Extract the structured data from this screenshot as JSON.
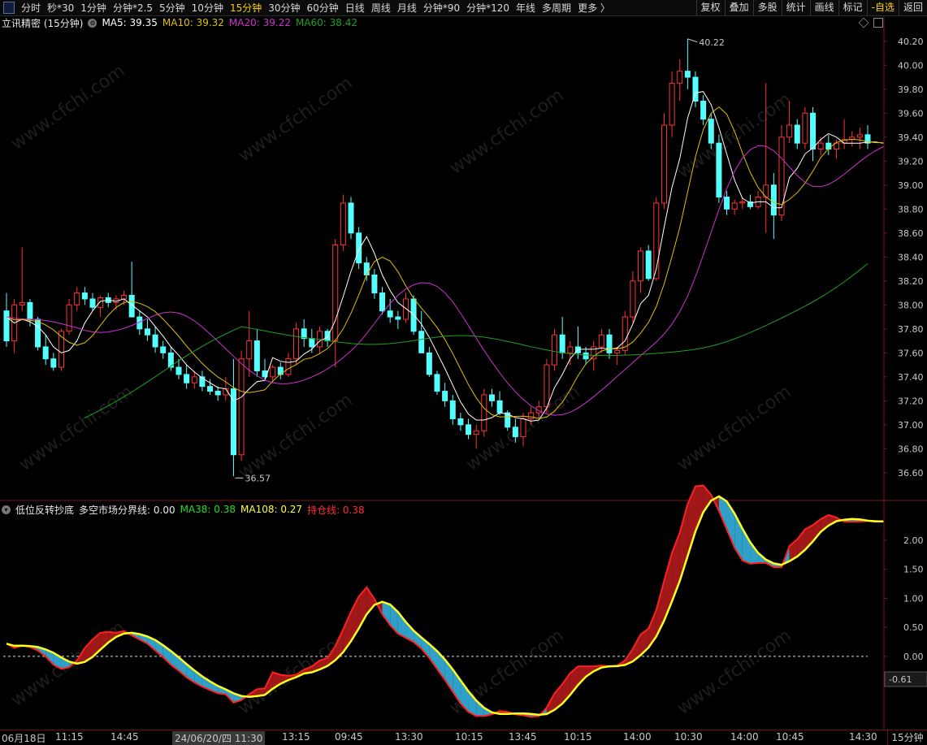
{
  "toolbar": {
    "periods": [
      "分时",
      "秒*30",
      "1分钟",
      "分钟*2.5",
      "5分钟",
      "10分钟",
      "15分钟",
      "30分钟",
      "60分钟",
      "日线",
      "周线",
      "月线",
      "分钟*90",
      "分钟*120",
      "年线",
      "多周期",
      "更多 〉"
    ],
    "active_period": "15分钟",
    "right_tools": [
      "复权",
      "叠加",
      "多股",
      "统计",
      "画线",
      "标记",
      "-自选",
      "返回"
    ]
  },
  "main_legend": {
    "title": "立讯精密 (15分钟)",
    "ma5": "MA5: 39.35",
    "ma10": "MA10: 39.32",
    "ma20": "MA20: 39.22",
    "ma60": "MA60: 38.42"
  },
  "sub_legend": {
    "title": "低位反转抄底",
    "dk": "多空市场分界线: 0.00",
    "ma38": "MA38: 0.38",
    "ma108": "MA108: 0.27",
    "hold": "持仓线: 0.38"
  },
  "annotations": {
    "high": "40.22",
    "low": "36.57"
  },
  "price_axis": [
    "40.20",
    "40.00",
    "39.80",
    "39.60",
    "39.40",
    "39.20",
    "39.00",
    "38.80",
    "38.60",
    "38.40",
    "38.20",
    "38.00",
    "37.80",
    "37.60",
    "37.40",
    "37.20",
    "37.00",
    "36.80",
    "36.60"
  ],
  "indicator_axis": [
    "2.00",
    "1.50",
    "1.00",
    "0.50",
    "0.00"
  ],
  "indicator_current": "-0.61",
  "time_labels": [
    "06月18日",
    "11:15",
    "14:45",
    "24/06/20/四 11:30",
    "13:15",
    "09:45",
    "13:30",
    "10:15",
    "13:45",
    "10:15",
    "14:00",
    "10:30",
    "14:00",
    "10:45",
    "14:30"
  ],
  "period_tag": "15分钟",
  "colors": {
    "up": "#ff3232",
    "down": "#54ffff",
    "ma5": "#ffffff",
    "ma10": "#e0c000",
    "ma20": "#d030d0",
    "ma60": "#20a020",
    "grid": "#3a0a0a"
  },
  "chart_data": {
    "type": "candlestick",
    "ylim": [
      36.45,
      40.3
    ],
    "candles": [
      [
        37.95,
        38.1,
        37.65,
        37.7
      ],
      [
        37.7,
        38.05,
        37.6,
        38.0
      ],
      [
        38.0,
        38.48,
        37.95,
        38.02
      ],
      [
        38.02,
        38.05,
        37.82,
        37.88
      ],
      [
        37.88,
        37.9,
        37.62,
        37.65
      ],
      [
        37.65,
        37.75,
        37.5,
        37.55
      ],
      [
        37.55,
        37.6,
        37.45,
        37.48
      ],
      [
        37.48,
        37.8,
        37.45,
        37.78
      ],
      [
        37.78,
        38.05,
        37.75,
        38.0
      ],
      [
        38.0,
        38.15,
        37.95,
        38.1
      ],
      [
        38.1,
        38.15,
        38.0,
        38.05
      ],
      [
        38.05,
        38.1,
        37.95,
        37.98
      ],
      [
        37.98,
        38.08,
        37.9,
        38.06
      ],
      [
        38.06,
        38.1,
        37.98,
        38.02
      ],
      [
        38.02,
        38.08,
        37.96,
        38.05
      ],
      [
        38.05,
        38.12,
        38.0,
        38.08
      ],
      [
        38.08,
        38.36,
        37.95,
        37.9
      ],
      [
        37.9,
        37.95,
        37.75,
        37.8
      ],
      [
        37.8,
        37.88,
        37.7,
        37.75
      ],
      [
        37.75,
        37.82,
        37.6,
        37.65
      ],
      [
        37.65,
        37.7,
        37.55,
        37.6
      ],
      [
        37.6,
        37.65,
        37.45,
        37.48
      ],
      [
        37.48,
        37.55,
        37.38,
        37.42
      ],
      [
        37.42,
        37.5,
        37.3,
        37.35
      ],
      [
        37.35,
        37.45,
        37.3,
        37.4
      ],
      [
        37.4,
        37.45,
        37.28,
        37.32
      ],
      [
        37.32,
        37.38,
        37.25,
        37.28
      ],
      [
        37.28,
        37.32,
        37.2,
        37.25
      ],
      [
        37.25,
        37.4,
        37.2,
        37.3
      ],
      [
        37.3,
        37.55,
        36.57,
        36.75
      ],
      [
        36.75,
        37.62,
        36.7,
        37.55
      ],
      [
        37.55,
        37.95,
        37.4,
        37.7
      ],
      [
        37.7,
        37.8,
        37.4,
        37.45
      ],
      [
        37.45,
        37.55,
        37.38,
        37.4
      ],
      [
        37.4,
        37.5,
        37.35,
        37.48
      ],
      [
        37.48,
        37.52,
        37.38,
        37.42
      ],
      [
        37.42,
        37.6,
        37.4,
        37.55
      ],
      [
        37.55,
        37.85,
        37.5,
        37.8
      ],
      [
        37.8,
        37.88,
        37.65,
        37.72
      ],
      [
        37.72,
        37.8,
        37.6,
        37.65
      ],
      [
        37.65,
        37.82,
        37.6,
        37.78
      ],
      [
        37.78,
        37.8,
        37.65,
        37.7
      ],
      [
        37.7,
        38.55,
        37.48,
        38.5
      ],
      [
        38.5,
        38.92,
        38.45,
        38.85
      ],
      [
        38.85,
        38.9,
        38.55,
        38.6
      ],
      [
        38.6,
        38.65,
        38.3,
        38.35
      ],
      [
        38.35,
        38.4,
        38.2,
        38.25
      ],
      [
        38.25,
        38.3,
        38.05,
        38.1
      ],
      [
        38.1,
        38.15,
        37.92,
        37.95
      ],
      [
        37.95,
        38.05,
        37.85,
        37.9
      ],
      [
        37.9,
        37.95,
        37.8,
        37.88
      ],
      [
        37.88,
        38.1,
        37.85,
        38.05
      ],
      [
        38.05,
        38.08,
        37.75,
        37.78
      ],
      [
        37.78,
        37.95,
        37.6,
        37.6
      ],
      [
        37.6,
        37.65,
        37.4,
        37.42
      ],
      [
        37.42,
        37.45,
        37.25,
        37.28
      ],
      [
        37.28,
        37.35,
        37.15,
        37.2
      ],
      [
        37.2,
        37.25,
        37.0,
        37.05
      ],
      [
        37.05,
        37.1,
        36.95,
        37.0
      ],
      [
        37.0,
        37.05,
        36.88,
        36.92
      ],
      [
        36.92,
        37.0,
        36.8,
        36.95
      ],
      [
        36.95,
        37.3,
        36.9,
        37.25
      ],
      [
        37.25,
        37.3,
        37.15,
        37.2
      ],
      [
        37.2,
        37.28,
        37.08,
        37.1
      ],
      [
        37.1,
        37.12,
        36.95,
        36.98
      ],
      [
        36.98,
        37.05,
        36.85,
        36.9
      ],
      [
        36.9,
        37.1,
        36.82,
        37.05
      ],
      [
        37.05,
        37.15,
        37.0,
        37.1
      ],
      [
        37.1,
        37.2,
        37.05,
        37.15
      ],
      [
        37.15,
        37.55,
        37.1,
        37.5
      ],
      [
        37.5,
        37.8,
        37.45,
        37.75
      ],
      [
        37.75,
        37.9,
        37.55,
        37.6
      ],
      [
        37.6,
        37.7,
        37.5,
        37.65
      ],
      [
        37.65,
        37.82,
        37.55,
        37.6
      ],
      [
        37.6,
        37.65,
        37.5,
        37.55
      ],
      [
        37.55,
        37.7,
        37.45,
        37.65
      ],
      [
        37.65,
        37.8,
        37.6,
        37.75
      ],
      [
        37.75,
        37.8,
        37.55,
        37.6
      ],
      [
        37.6,
        37.65,
        37.5,
        37.62
      ],
      [
        37.62,
        37.95,
        37.58,
        37.9
      ],
      [
        37.9,
        38.28,
        37.85,
        38.2
      ],
      [
        38.2,
        38.48,
        38.1,
        38.45
      ],
      [
        38.45,
        38.5,
        38.2,
        38.22
      ],
      [
        38.22,
        38.9,
        38.2,
        38.85
      ],
      [
        38.85,
        39.6,
        38.8,
        39.5
      ],
      [
        39.5,
        39.95,
        39.4,
        39.85
      ],
      [
        39.85,
        40.05,
        39.7,
        39.95
      ],
      [
        39.95,
        40.22,
        39.8,
        39.9
      ],
      [
        39.9,
        39.95,
        39.65,
        39.7
      ],
      [
        39.7,
        39.75,
        39.5,
        39.55
      ],
      [
        39.55,
        39.6,
        39.3,
        39.35
      ],
      [
        39.35,
        39.42,
        38.85,
        38.9
      ],
      [
        38.9,
        38.95,
        38.75,
        38.8
      ],
      [
        38.8,
        38.88,
        38.75,
        38.85
      ],
      [
        38.85,
        38.9,
        38.8,
        38.86
      ],
      [
        38.86,
        38.92,
        38.8,
        38.82
      ],
      [
        38.82,
        38.95,
        38.8,
        38.9
      ],
      [
        38.9,
        39.85,
        38.6,
        39.0
      ],
      [
        39.0,
        39.1,
        38.55,
        38.75
      ],
      [
        38.75,
        39.5,
        38.7,
        39.4
      ],
      [
        39.4,
        39.7,
        39.35,
        39.5
      ],
      [
        39.5,
        39.55,
        39.3,
        39.35
      ],
      [
        39.35,
        39.65,
        39.3,
        39.6
      ],
      [
        39.6,
        39.65,
        39.2,
        39.3
      ],
      [
        39.3,
        39.4,
        39.25,
        39.35
      ],
      [
        39.35,
        39.42,
        39.25,
        39.3
      ],
      [
        39.3,
        39.38,
        39.22,
        39.35
      ],
      [
        39.35,
        39.55,
        39.3,
        39.38
      ],
      [
        39.38,
        39.45,
        39.32,
        39.4
      ],
      [
        39.4,
        39.48,
        39.3,
        39.42
      ],
      [
        39.42,
        39.5,
        39.3,
        39.35
      ]
    ],
    "ma5": [
      37.9,
      37.85,
      37.88,
      37.86,
      37.82,
      37.75,
      37.65,
      37.6,
      37.62,
      37.7,
      37.85,
      37.95,
      38.03,
      38.04,
      38.03,
      38.05,
      38.0,
      37.95,
      37.9,
      37.82,
      37.74,
      37.65,
      37.58,
      37.5,
      37.44,
      37.39,
      37.35,
      37.31,
      37.3,
      37.2,
      37.23,
      37.3,
      37.36,
      37.37,
      37.56,
      37.53,
      37.52,
      37.53,
      37.59,
      37.63,
      37.7,
      37.73,
      37.87,
      38.07,
      38.28,
      38.46,
      38.57,
      38.43,
      38.25,
      38.12,
      38.02,
      37.97,
      37.92,
      37.84,
      37.73,
      37.6,
      37.47,
      37.33,
      37.19,
      37.09,
      37.04,
      37.04,
      37.06,
      37.1,
      37.09,
      37.06,
      37.05,
      37.03,
      37.04,
      37.14,
      37.31,
      37.42,
      37.55,
      37.63,
      37.63,
      37.63,
      37.64,
      37.63,
      37.64,
      37.7,
      37.84,
      38.01,
      38.08,
      38.3,
      38.65,
      38.98,
      39.22,
      39.56,
      39.77,
      39.78,
      39.67,
      39.48,
      39.26,
      39.04,
      38.89,
      38.85,
      38.86,
      38.86,
      38.81,
      38.81,
      39.06,
      39.14,
      39.26,
      39.31,
      39.38,
      39.43,
      39.4,
      39.35,
      39.35,
      39.35,
      39.36,
      39.36,
      39.35
    ]
  }
}
